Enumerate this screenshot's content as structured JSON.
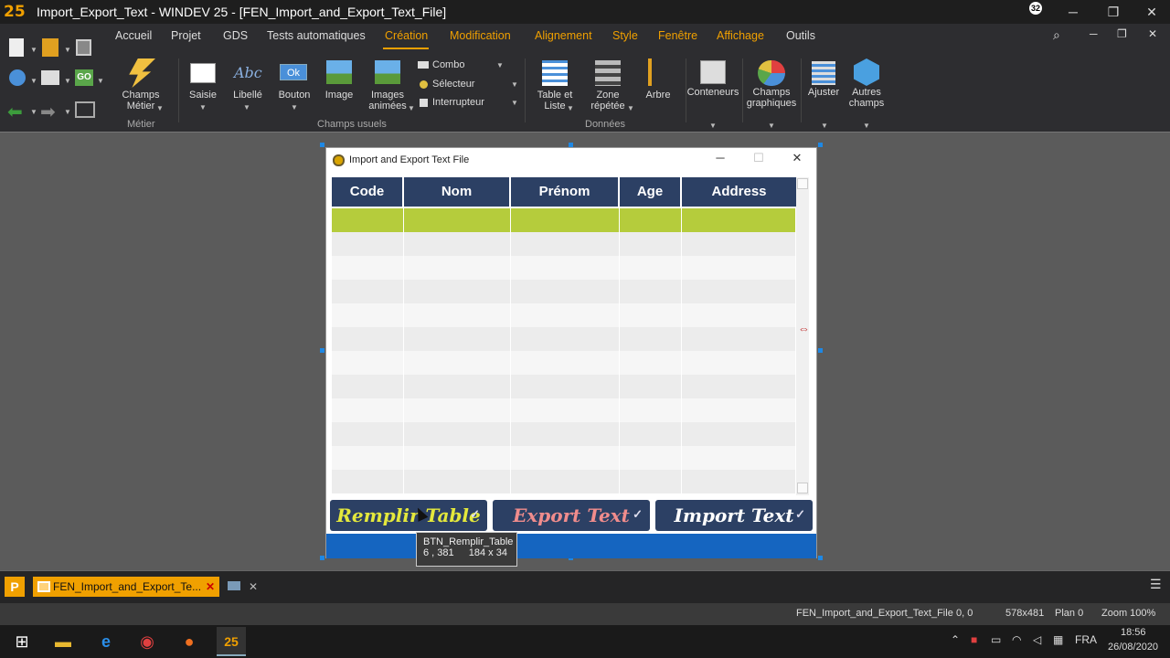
{
  "window": {
    "title": "Import_Export_Text - WINDEV 25 - [FEN_Import_and_Export_Text_File]",
    "notification_count": "32",
    "minimize": "─",
    "maximize": "❐",
    "close": "✕"
  },
  "ribbon": {
    "tabs": [
      "Accueil",
      "Projet",
      "GDS",
      "Tests automatiques",
      "Création",
      "Modification",
      "Alignement",
      "Style",
      "Fenêtre",
      "Affichage",
      "Outils"
    ],
    "active_tab": "Création",
    "buttons": {
      "champs_metier": "Champs Métier",
      "saisie": "Saisie",
      "libelle": "Libellé",
      "bouton": "Bouton",
      "image": "Image",
      "images_animees": "Images animées",
      "combo": "Combo",
      "selecteur": "Sélecteur",
      "interrupteur": "Interrupteur",
      "table_liste": "Table et Liste",
      "zone_repetee": "Zone répétée",
      "arbre": "Arbre",
      "conteneurs": "Conteneurs",
      "champs_graphiques": "Champs graphiques",
      "ajuster": "Ajuster",
      "autres_champs": "Autres champs",
      "ok_label": "Ok",
      "abc_label": "Abc"
    },
    "groups": {
      "metier": "Métier",
      "champs_usuels": "Champs usuels",
      "donnees": "Données"
    }
  },
  "design_window": {
    "title": "Import and Export Text File",
    "table": {
      "columns": [
        "Code",
        "Nom",
        "Prénom",
        "Age",
        "Address"
      ]
    },
    "buttons": {
      "remplir": "Remplir Table",
      "export": "Export Text",
      "import": "Import Text"
    },
    "check": "✓"
  },
  "tooltip": {
    "name": "BTN_Remplir_Table",
    "position": "6 , 381",
    "size": "184 x 34"
  },
  "lower_panel": {
    "p_icon": "P",
    "doc_tab": "FEN_Import_and_Export_Te...",
    "close": "✕"
  },
  "status_bar": {
    "window_name": "FEN_Import_and_Export_Text_File",
    "coords": "0, 0",
    "size": "578x481",
    "plan": "Plan 0",
    "zoom": "Zoom 100%"
  },
  "taskbar": {
    "language": "FRA",
    "time": "18:56",
    "date": "26/08/2020"
  },
  "colors": {
    "accent_orange": "#f0a000",
    "table_header": "#2c4064",
    "selected_row": "#b5cc3c",
    "remplir_text": "#e4e83c",
    "export_text": "#f08c8c",
    "import_text": "#ffffff",
    "bottom_bar": "#1565c0"
  }
}
